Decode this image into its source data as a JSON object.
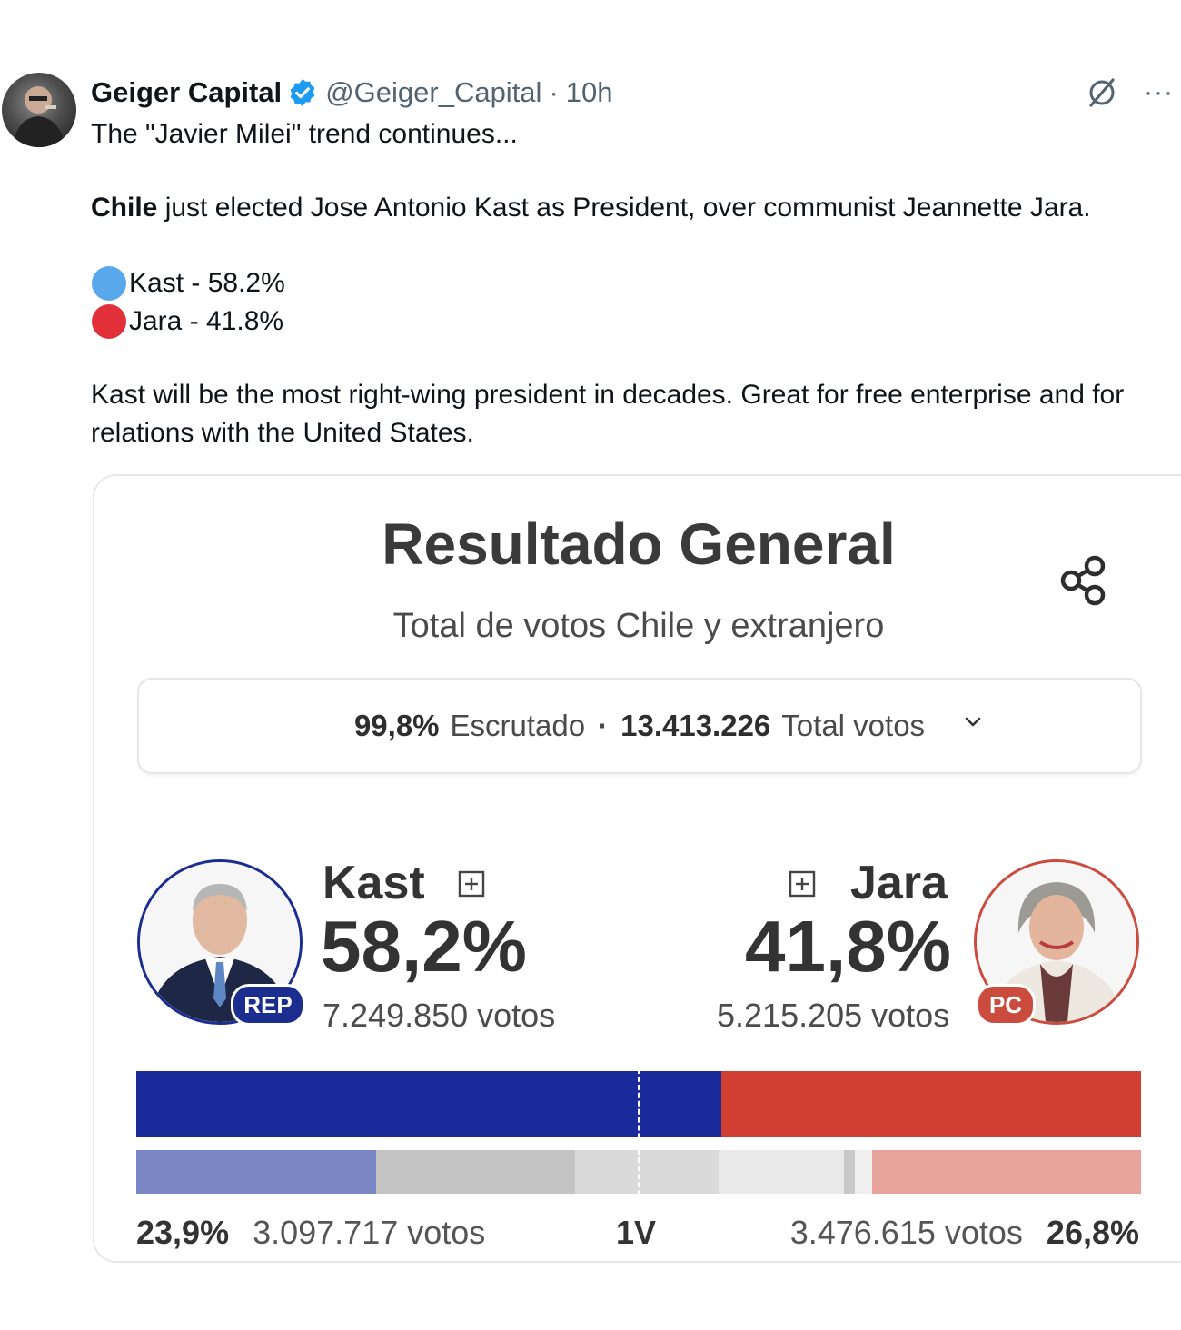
{
  "tweet": {
    "author_name": "Geiger Capital",
    "handle": "@Geiger_Capital",
    "separator": "·",
    "time": "10h",
    "verified_icon": "verified-badge-icon",
    "intro": "The \"Javier Milei\" trend continues...",
    "country": "Chile",
    "headline_rest": " just elected Jose Antonio Kast as President, over communist Jeannette Jara.",
    "results": [
      {
        "text": "Kast - 58.2%",
        "color": "#5aa8ec"
      },
      {
        "text": "Jara - 41.8%",
        "color": "#e2303a"
      }
    ],
    "closing": "Kast will be the most right-wing president in decades. Great for free enterprise and for relations with the United States.",
    "more_label": "···"
  },
  "card": {
    "title": "Resultado General",
    "subtitle": "Total de votos Chile y extranjero",
    "summary": {
      "scrutinized_pct": "99,8%",
      "scrutinized_label": "Escrutado",
      "dot": "·",
      "total_votes": "13.413.226",
      "total_label": "Total votos"
    },
    "candidates": [
      {
        "name": "Kast",
        "party": "REP",
        "percent": "58,2%",
        "votes": "7.249.850 votos",
        "color": "#1b2a9a"
      },
      {
        "name": "Jara",
        "party": "PC",
        "percent": "41,8%",
        "votes": "5.215.205 votos",
        "color": "#d23f33"
      }
    ],
    "first_round": {
      "label": "1V",
      "left_percent": "23,9%",
      "left_votes": "3.097.717 votos",
      "right_percent": "26,8%",
      "right_votes": "3.476.615 votos"
    }
  },
  "chart_data": {
    "type": "bar",
    "series": [
      {
        "name": "Kast",
        "values": [
          58.2
        ]
      },
      {
        "name": "Jara",
        "values": [
          41.8
        ]
      }
    ],
    "first_round_segments": [
      {
        "color": "#7b86c7",
        "value": 23.9
      },
      {
        "color": "#c4c4c4",
        "value": 19.8
      },
      {
        "color": "#dadada",
        "value": 14.3
      },
      {
        "color": "#e9e9e9",
        "value": 12.4
      },
      {
        "color": "#c8c8c8",
        "value": 1.1
      },
      {
        "color": "#f0f0f0",
        "value": 1.7
      },
      {
        "color": "#e8a39c",
        "value": 26.8
      }
    ]
  }
}
